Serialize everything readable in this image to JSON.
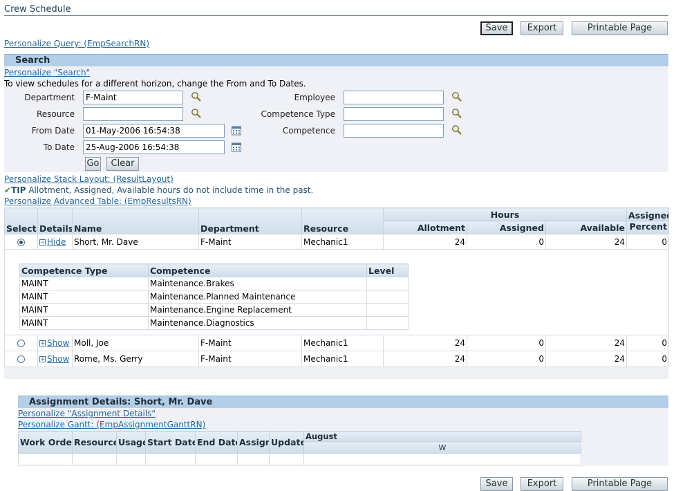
{
  "page": {
    "title": "Crew Schedule"
  },
  "top_buttons": {
    "save": "Save",
    "export": "Export",
    "printable": "Printable Page"
  },
  "links": {
    "personalize_query": "Personalize Query: (EmpSearchRN)",
    "personalize_search": "Personalize \"Search\"",
    "personalize_stack": "Personalize Stack Layout: (ResultLayout)",
    "personalize_table": "Personalize Advanced Table: (EmpResultsRN)",
    "personalize_assign": "Personalize \"Assignment Details\"",
    "personalize_gantt": "Personalize Gantt: (EmpAssignmentGanttRN)"
  },
  "search": {
    "header": "Search",
    "instruction": "To view schedules for a different horizon, change the From and To Dates.",
    "department_label": "Department",
    "department_value": "F-Maint",
    "resource_label": "Resource",
    "resource_value": "",
    "from_label": "From Date",
    "from_value": "01-May-2006 16:54:38",
    "to_label": "To Date",
    "to_value": "25-Aug-2006 16:54:38",
    "employee_label": "Employee",
    "employee_value": "",
    "comp_type_label": "Competence Type",
    "comp_type_value": "",
    "competence_label": "Competence",
    "competence_value": "",
    "go": "Go",
    "clear": "Clear"
  },
  "tip": {
    "prefix": "TIP",
    "text": "Allotment, Assigned, Available hours do not include time in the past."
  },
  "results": {
    "group_hours": "Hours",
    "headers": {
      "select": "Select",
      "details": "Details",
      "name": "Name",
      "department": "Department",
      "resource": "Resource",
      "allotment": "Allotment",
      "assigned": "Assigned",
      "available": "Available",
      "assigned_pct_1": "Assigned",
      "assigned_pct_2": "Percent"
    },
    "rows": [
      {
        "toggle": "Hide",
        "name": "Short, Mr. Dave",
        "department": "F-Maint",
        "resource": "Mechanic1",
        "allotment": "24",
        "assigned": "0",
        "available": "24",
        "percent": "0"
      },
      {
        "toggle": "Show",
        "name": "Moll, Joe",
        "department": "F-Maint",
        "resource": "Mechanic1",
        "allotment": "24",
        "assigned": "0",
        "available": "24",
        "percent": "0"
      },
      {
        "toggle": "Show",
        "name": "Rome, Ms. Gerry",
        "department": "F-Maint",
        "resource": "Mechanic1",
        "allotment": "24",
        "assigned": "0",
        "available": "24",
        "percent": "0"
      }
    ],
    "competence_headers": {
      "type": "Competence Type",
      "competence": "Competence",
      "level": "Level"
    },
    "competences": [
      {
        "type": "MAINT",
        "competence": "Maintenance.Brakes",
        "level": ""
      },
      {
        "type": "MAINT",
        "competence": "Maintenance.Planned Maintenance",
        "level": ""
      },
      {
        "type": "MAINT",
        "competence": "Maintenance.Engine Replacement",
        "level": ""
      },
      {
        "type": "MAINT",
        "competence": "Maintenance.Diagnostics",
        "level": ""
      }
    ]
  },
  "assignment": {
    "header": "Assignment Details: Short, Mr. Dave",
    "headers": {
      "work_order": "Work Order",
      "resource": "Resource",
      "usage": "Usage",
      "start": "Start Date",
      "end": "End Date",
      "assign": "Assign",
      "update": "Update"
    },
    "month": "August",
    "week": "W"
  },
  "bottom_buttons": {
    "save": "Save",
    "export": "Export",
    "printable": "Printable Page"
  }
}
